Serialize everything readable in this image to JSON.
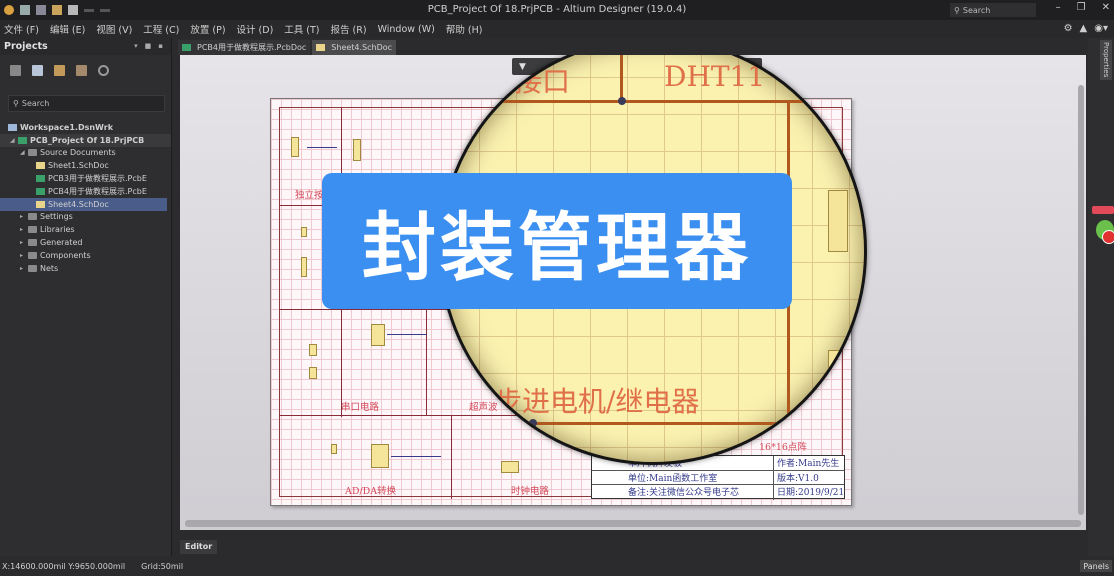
{
  "window": {
    "title": "PCB_Project Of 18.PrjPCB - Altium Designer (19.0.4)",
    "search_placeholder": "Search",
    "controls": [
      "minimize",
      "restore",
      "close"
    ]
  },
  "menu": {
    "items": [
      "文件 (F)",
      "编辑 (E)",
      "视图 (V)",
      "工程 (C)",
      "放置 (P)",
      "设计 (D)",
      "工具 (T)",
      "报告 (R)",
      "Window (W)",
      "帮助 (H)"
    ],
    "right_icons": [
      "gear-icon",
      "bell-icon",
      "user-icon"
    ]
  },
  "projects_panel": {
    "title": "Projects",
    "search_placeholder": "Search",
    "tree": [
      {
        "label": "Workspace1.DsnWrk",
        "level": 0,
        "icon": "workspace"
      },
      {
        "label": "PCB_Project Of 18.PrjPCB",
        "level": 0,
        "icon": "pcb-project",
        "highlight": true
      },
      {
        "label": "Source Documents",
        "level": 1,
        "icon": "folder"
      },
      {
        "label": "Sheet1.SchDoc",
        "level": 2,
        "icon": "sch"
      },
      {
        "label": "PCB3用于做教程展示.PcbE",
        "level": 2,
        "icon": "pcb"
      },
      {
        "label": "PCB4用于做教程展示.PcbE",
        "level": 2,
        "icon": "pcb"
      },
      {
        "label": "Sheet4.SchDoc",
        "level": 2,
        "icon": "sch",
        "selected": true
      },
      {
        "label": "Settings",
        "level": 1,
        "icon": "folder"
      },
      {
        "label": "Libraries",
        "level": 1,
        "icon": "folder"
      },
      {
        "label": "Generated",
        "level": 1,
        "icon": "folder"
      },
      {
        "label": "Components",
        "level": 1,
        "icon": "folder"
      },
      {
        "label": "Nets",
        "level": 1,
        "icon": "folder"
      }
    ]
  },
  "doc_tabs": [
    {
      "label": "PCB4用于做教程展示.PcbDoc",
      "type": "pcb",
      "active": false
    },
    {
      "label": "Sheet4.SchDoc",
      "type": "sch",
      "active": true
    }
  ],
  "schematic": {
    "sections": [
      "独立按键",
      "串口电路",
      "超声波",
      "AD/DA转换",
      "时钟电路",
      "16*16点阵"
    ],
    "magnified_labels": [
      "接口",
      "DHT11",
      "步进电机/继电器"
    ],
    "title_block": {
      "board": "单片机开发板",
      "author": "作者:Main先生",
      "unit": "单位:Main函数工作室",
      "version": "版本:V1.0",
      "note": "备注:关注微信公众号电子芯",
      "date": "日期:2019/9/21"
    }
  },
  "overlay_caption": "封装管理器",
  "editor_tab": "Editor",
  "properties_tab": "Properties",
  "status": {
    "coords": "X:14600.000mil Y:9650.000mil",
    "grid": "Grid:50mil",
    "panels_button": "Panels"
  }
}
